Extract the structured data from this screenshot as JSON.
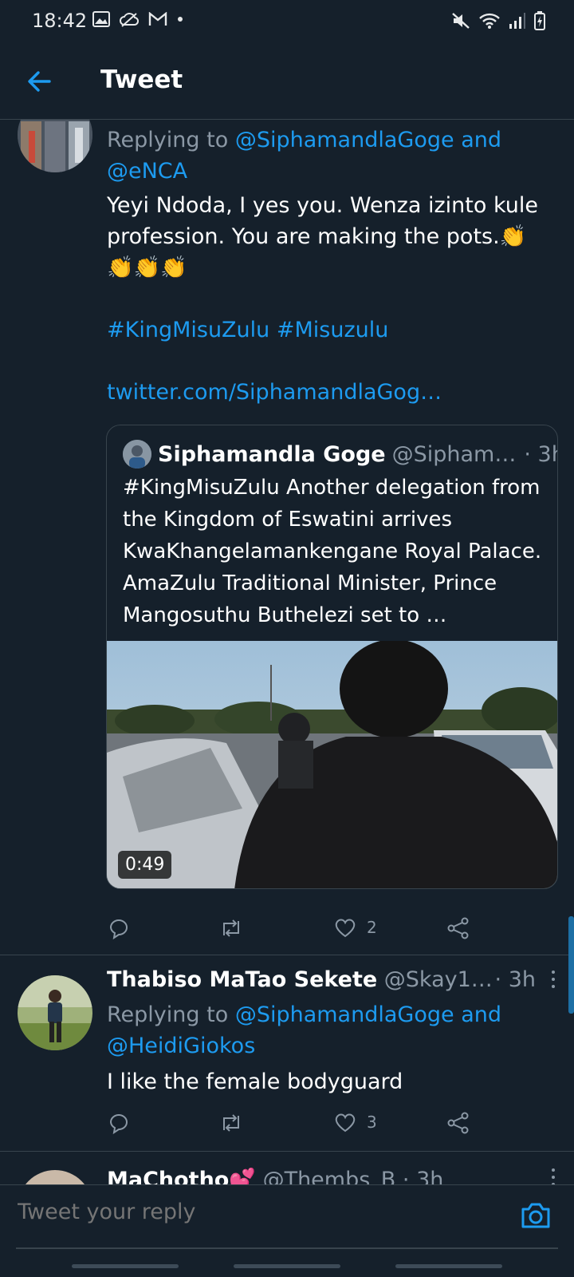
{
  "status_bar": {
    "time": "18:42",
    "left_icons": [
      "image-icon",
      "cloud-icon",
      "gmail-icon",
      "dot-icon"
    ],
    "right_icons": [
      "mute-icon",
      "wifi-icon",
      "signal-icon",
      "battery-charging-icon"
    ]
  },
  "header": {
    "title": "Tweet",
    "back_icon": "arrow-left-icon"
  },
  "colors": {
    "background": "#15202b",
    "link": "#1d9bf0",
    "muted": "#8b98a5",
    "divider": "#38444d"
  },
  "tweet1": {
    "replying_prefix": "Replying to",
    "mention1": "@SiphamandlaGoge",
    "and_word": "and",
    "mention2": "@eNCA",
    "text": "Yeyi Ndoda, I yes you. Wenza izinto kule profession. You are making the pots.",
    "hashtag1": "#KingMisuZulu",
    "hashtag2": "#Misuzulu",
    "link": "twitter.com/SiphamandlaGog…",
    "quote": {
      "name": "Siphamandla Goge",
      "handle": "@Sipham…",
      "time": "· 3h",
      "text": "#KingMisuZulu Another delegation from the Kingdom of Eswatini arrives KwaKhangelamankengane Royal Palace. AmaZulu Traditional Minister, Prince Mangosuthu Buthelezi set to …",
      "video_duration": "0:49"
    },
    "likes": "2"
  },
  "tweet2": {
    "name": "Thabiso MaTao Sekete",
    "handle": "@Skay1…",
    "time": "· 3h",
    "replying_prefix": "Replying to",
    "mention1": "@SiphamandlaGoge",
    "and_word": "and",
    "mention2": "@HeidiGiokos",
    "text": "I like the female bodyguard",
    "likes": "3"
  },
  "tweet3": {
    "name_partial": "MaChotho",
    "handle_partial": "@Thembs_B · 3h"
  },
  "reply": {
    "placeholder": "Tweet your reply"
  }
}
